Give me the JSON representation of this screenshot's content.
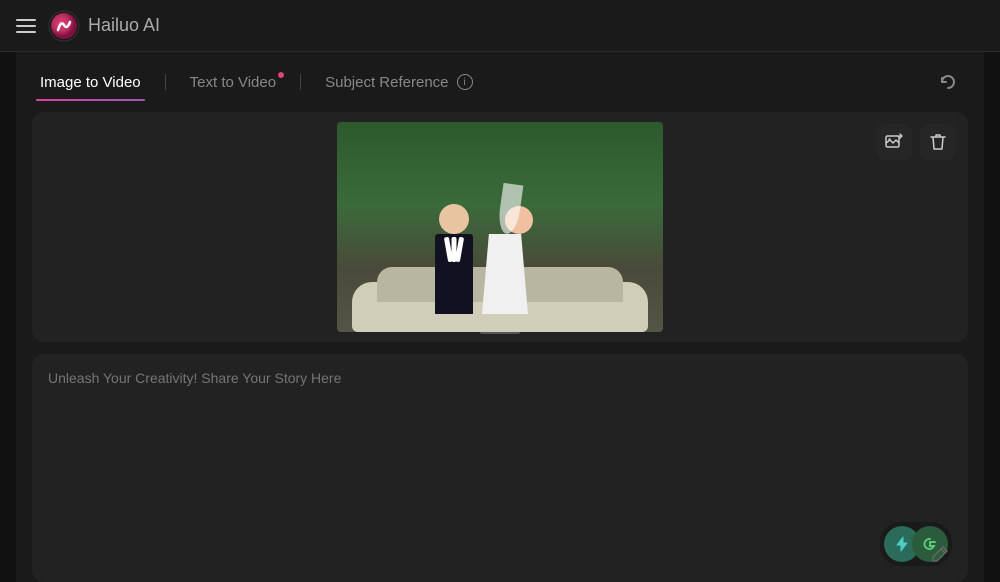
{
  "header": {
    "menu_label": "menu",
    "logo_name": "Hailuo",
    "logo_suffix": " AI"
  },
  "tabs": {
    "items": [
      {
        "id": "image-to-video",
        "label": "Image to Video",
        "active": true,
        "dot": false
      },
      {
        "id": "text-to-video",
        "label": "Text to Video",
        "active": false,
        "dot": true
      },
      {
        "id": "subject-reference",
        "label": "Subject Reference",
        "active": false,
        "dot": false,
        "info": true
      }
    ],
    "refresh_label": "refresh"
  },
  "image_area": {
    "alt": "Wedding couple photo",
    "replace_icon": "image-replace",
    "delete_icon": "trash"
  },
  "prompt": {
    "placeholder": "Unleash Your Creativity! Share Your Story Here",
    "value": ""
  },
  "toolbar": {
    "generate_icon_1": "⚡",
    "generate_icon_2": "G",
    "pen_icon": "✏"
  }
}
